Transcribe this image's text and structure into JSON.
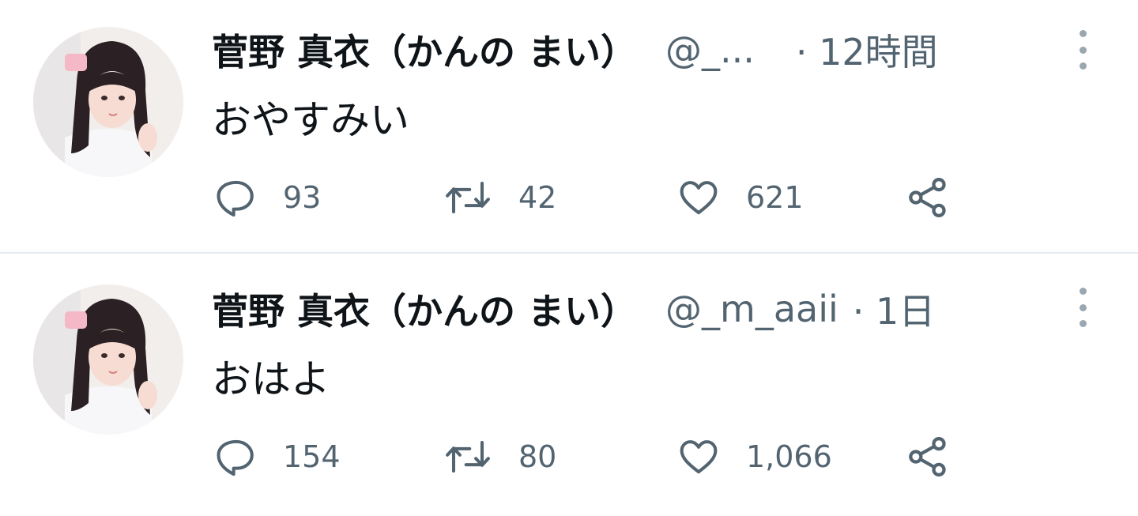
{
  "colors": {
    "text_primary": "#0f1419",
    "text_secondary": "#536471",
    "divider": "#e6ecf0",
    "icon": "#536471"
  },
  "tweets": [
    {
      "display_name": "菅野 真衣（かんの まい）",
      "handle": "@_...",
      "time": "· 12時間",
      "text": "おやすみい",
      "reply_count": "93",
      "retweet_count": "42",
      "like_count": "621",
      "avatar_alt": "菅野 真衣",
      "icons": [
        "more-icon",
        "reply-icon",
        "retweet-icon",
        "like-icon",
        "share-icon"
      ]
    },
    {
      "display_name": "菅野 真衣（かんの まい）",
      "handle": "@_m_aaii",
      "time": "· 1日",
      "text": "おはよ",
      "reply_count": "154",
      "retweet_count": "80",
      "like_count": "1,066",
      "avatar_alt": "菅野 真衣",
      "icons": [
        "more-icon",
        "reply-icon",
        "retweet-icon",
        "like-icon",
        "share-icon"
      ]
    }
  ]
}
